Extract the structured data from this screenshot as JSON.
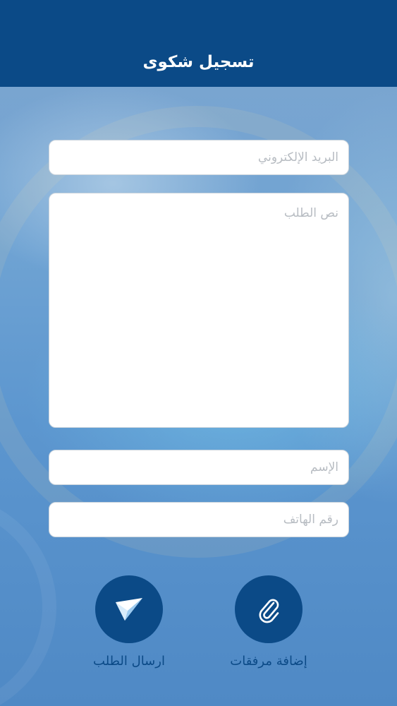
{
  "header": {
    "title": "تسجيل شكوى"
  },
  "form": {
    "email_placeholder": "البريد الإلكتروني",
    "body_placeholder": "نص الطلب",
    "name_placeholder": "الإسم",
    "phone_placeholder": "رقم الهاتف"
  },
  "actions": {
    "send_label": "ارسال الطلب",
    "attach_label": "إضافة مرفقات"
  },
  "icons": {
    "send": "paper-plane-icon",
    "attach": "paperclip-icon"
  },
  "colors": {
    "brand": "#0b4a87",
    "background": "#6fa3d3"
  }
}
